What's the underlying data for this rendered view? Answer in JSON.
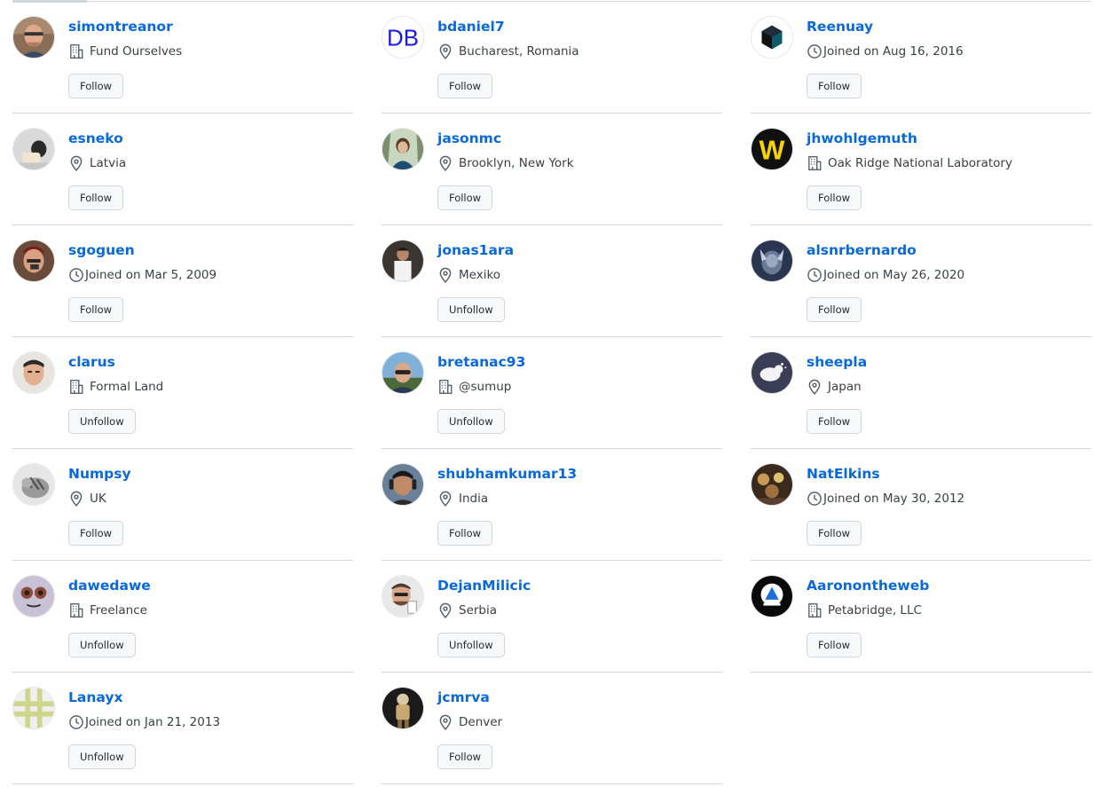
{
  "users": [
    {
      "username": "simontreanor",
      "meta_type": "company",
      "meta_icon": "building-icon",
      "meta": "Fund Ourselves",
      "action": "Follow"
    },
    {
      "username": "bdaniel7",
      "meta_type": "location",
      "meta_icon": "location-pin-icon",
      "meta": "Bucharest, Romania",
      "action": "Follow",
      "avatar_text": "DB"
    },
    {
      "username": "Reenuay",
      "meta_type": "joined",
      "meta_icon": "clock-icon",
      "meta": "Joined on Aug 16, 2016",
      "action": "Follow"
    },
    {
      "username": "esneko",
      "meta_type": "location",
      "meta_icon": "location-pin-icon",
      "meta": "Latvia",
      "action": "Follow"
    },
    {
      "username": "jasonmc",
      "meta_type": "location",
      "meta_icon": "location-pin-icon",
      "meta": "Brooklyn, New York",
      "action": "Follow"
    },
    {
      "username": "jhwohlgemuth",
      "meta_type": "company",
      "meta_icon": "building-icon",
      "meta": "Oak Ridge National Laboratory",
      "action": "Follow",
      "avatar_text": "W"
    },
    {
      "username": "sgoguen",
      "meta_type": "joined",
      "meta_icon": "clock-icon",
      "meta": "Joined on Mar 5, 2009",
      "action": "Follow"
    },
    {
      "username": "jonas1ara",
      "meta_type": "location",
      "meta_icon": "location-pin-icon",
      "meta": "Mexiko",
      "action": "Unfollow"
    },
    {
      "username": "alsnrbernardo",
      "meta_type": "joined",
      "meta_icon": "clock-icon",
      "meta": "Joined on May 26, 2020",
      "action": "Follow"
    },
    {
      "username": "clarus",
      "meta_type": "company",
      "meta_icon": "building-icon",
      "meta": "Formal Land",
      "action": "Unfollow"
    },
    {
      "username": "bretanac93",
      "meta_type": "company",
      "meta_icon": "building-icon",
      "meta": "@sumup",
      "action": "Unfollow"
    },
    {
      "username": "sheepla",
      "meta_type": "location",
      "meta_icon": "location-pin-icon",
      "meta": "Japan",
      "action": "Follow"
    },
    {
      "username": "Numpsy",
      "meta_type": "location",
      "meta_icon": "location-pin-icon",
      "meta": "UK",
      "action": "Follow"
    },
    {
      "username": "shubhamkumar13",
      "meta_type": "location",
      "meta_icon": "location-pin-icon",
      "meta": "India",
      "action": "Follow"
    },
    {
      "username": "NatElkins",
      "meta_type": "joined",
      "meta_icon": "clock-icon",
      "meta": "Joined on May 30, 2012",
      "action": "Follow"
    },
    {
      "username": "dawedawe",
      "meta_type": "company",
      "meta_icon": "building-icon",
      "meta": "Freelance",
      "action": "Unfollow"
    },
    {
      "username": "DejanMilicic",
      "meta_type": "location",
      "meta_icon": "location-pin-icon",
      "meta": "Serbia",
      "action": "Unfollow"
    },
    {
      "username": "Aaronontheweb",
      "meta_type": "company",
      "meta_icon": "building-icon",
      "meta": "Petabridge, LLC",
      "action": "Follow"
    },
    {
      "username": "Lanayx",
      "meta_type": "joined",
      "meta_icon": "clock-icon",
      "meta": "Joined on Jan 21, 2013",
      "action": "Unfollow"
    },
    {
      "username": "jcmrva",
      "meta_type": "location",
      "meta_icon": "location-pin-icon",
      "meta": "Denver",
      "action": "Follow"
    }
  ],
  "colors": {
    "link": "#0969da",
    "border": "#d0d7de",
    "button_bg": "#f6f8fa"
  }
}
